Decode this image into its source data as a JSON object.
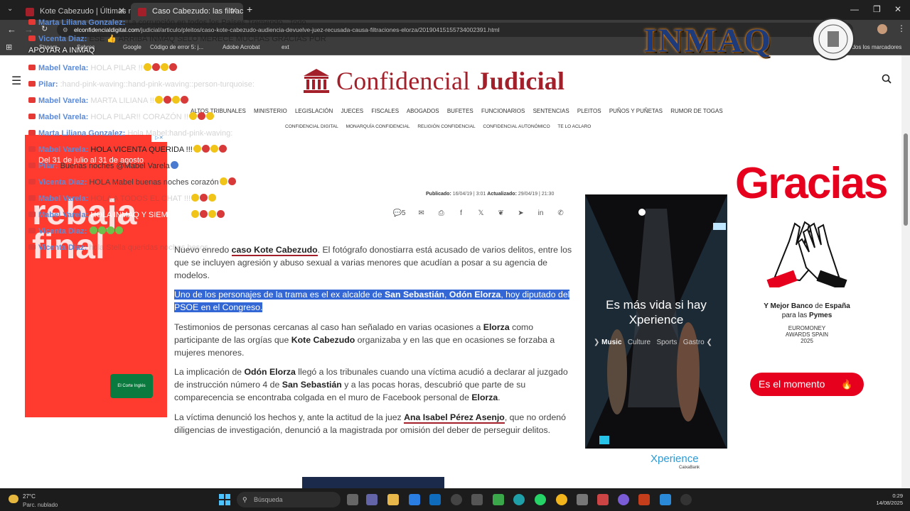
{
  "browser": {
    "tabs": [
      {
        "label": "Kote Cabezudo | Últimas notici",
        "active": false
      },
      {
        "label": "Caso Cabezudo: las filtraciones",
        "active": true
      }
    ],
    "url_host": "elconfidencialdigital.com",
    "url_path": "/judicial/articulo/pleitos/caso-kote-cabezudo-audiencia-devuelve-juez-recusada-causa-filtraciones-elorza/20190415155734002391.html",
    "bookmarks": [
      "Stream",
      "Sobres",
      "Google",
      "Código de error 5: j...",
      "Adobe Acrobat",
      "ext",
      "Todos los marcadores"
    ]
  },
  "chat": [
    {
      "name": "Marta Liliana Gonzalez",
      "text": "La corrupción en todos los Países Tremendo...Todo...",
      "style": "dark"
    },
    {
      "name": "Vicenta Diaz",
      "text": "ESE 👍 ARRIBA INMAQ SELO MERECE MUCHAS GRACIAS POR",
      "style": "dark"
    },
    {
      "name": "",
      "text": "APOYAR A INMAQ",
      "style": "white"
    },
    {
      "name": "Mabel Varela",
      "text": "HOLA PILAR !!",
      "style": "faint"
    },
    {
      "name": "Pilar",
      "text": ":hand-pink-waving::hand-pink-waving::person-turquoise:",
      "style": "faint"
    },
    {
      "name": "Mabel Varela",
      "text": "MARTA LILIANA !!",
      "style": "faint"
    },
    {
      "name": "Mabel Varela",
      "text": "HOLA PILAR!! CORAZÓN !!",
      "style": "faint"
    },
    {
      "name": "Marta Liliana Gonzalez",
      "text": "Hola Mabel:hand-pink-waving:",
      "style": "faint"
    },
    {
      "name": "Mabel Varela",
      "text": "HOLA VICENTA QUERIDA !!!",
      "style": "dark"
    },
    {
      "name": "Pilar",
      "text": "Buenas noches @Mabel Varela",
      "style": "faint"
    },
    {
      "name": "Vicenta Diaz",
      "text": "HOLA Mabel buenas noches corazón",
      "style": "faint"
    },
    {
      "name": "Mabel Varela",
      "text": "HOLA A TODOS EL CHAT !!!",
      "style": "faint"
    },
    {
      "name": "Mabel Varela",
      "text": "HOLA INMAQ Y SIEMPRE !!",
      "style": "dark"
    },
    {
      "name": "Vicenta Diaz",
      "text": "",
      "style": "faint"
    },
    {
      "name": "Vicenta Diaz",
      "text": "hola Stella queridas noches besos",
      "style": "faint"
    }
  ],
  "watermark": "INMAQ",
  "site": {
    "logo_light": "Confidencial",
    "logo_bold": "Judicial",
    "nav_main": [
      "ALTOS TRIBUNALES",
      "MINISTERIO",
      "LEGISLACIÓN",
      "JUECES",
      "FISCALES",
      "ABOGADOS",
      "BUFETES",
      "FUNCIONARIOS",
      "SENTENCIAS",
      "PLEITOS",
      "PUÑOS Y PUÑETAS",
      "RUMOR DE TOGAS"
    ],
    "nav_secondary": [
      "CONFIDENCIAL DIGITAL",
      "MONARQUÍA CONFIDENCIAL",
      "RELIGIÓN CONFIDENCIAL",
      "CONFIDENCIAL AUTONÓMICO",
      "TE LO ACLARO"
    ]
  },
  "article": {
    "published_label": "Publicado:",
    "published": "16/04/19 | 3:01",
    "updated_label": "Actualizado:",
    "updated": "29/04/19 | 21:30",
    "comments": "5",
    "p1_a": "Nuevo enredo ",
    "p1_link": "caso Kote Cabezudo",
    "p1_b": ". El fotógrafo donostiarra está acusado de varios delitos, entre los que se incluyen agresión y abuso sexual a varias menores que acudían a posar a su agencia de modelos.",
    "p2_a": "Uno de los personajes de la trama es el ex alcalde de ",
    "p2_b1": "San Sebastián",
    "p2_c": ", ",
    "p2_b2": "Odón Elorza",
    "p2_d": ", hoy diputado del PSOE en el Congreso.",
    "p3_a": "Testimonios de personas cercanas al caso han señalado en varias ocasiones a ",
    "p3_b1": "Elorza",
    "p3_c": " como participante de las orgías que ",
    "p3_b2": "Kote Cabezudo",
    "p3_d": " organizaba y en las que en ocasiones se forzaba a mujeres menores.",
    "p4_a": "La implicación de ",
    "p4_b1": "Odón Elorza",
    "p4_c": " llegó a los tribunales cuando una víctima acudió a declarar al juzgado de instrucción número 4 de ",
    "p4_b2": "San Sebastián",
    "p4_d": " y a las pocas horas, descubrió que parte de su comparecencia se encontraba colgada en el muro de Facebook personal de ",
    "p4_b3": "Elorza",
    "p4_e": ".",
    "p5_a": "La víctima denunció los hechos y, ante la actitud de la juez ",
    "p5_link": "Ana Isabel Pérez Asenjo",
    "p5_b": ", que no ordenó diligencias de investigación, denunció  a la magistrada por omisión del deber de perseguir delitos."
  },
  "ads": {
    "left_date": "Del 31 de julio al 31 de agosto",
    "left_big": "rebaja final",
    "left_brand": "El Corte Inglés",
    "mid_slogan": "Es más vida si hay Xperience",
    "mid_tags": [
      "Music",
      "Culture",
      "Sports",
      "Gastro"
    ],
    "mid_brand": "Xperience",
    "mid_sub": "CaixaBank",
    "right_big": "Gracias",
    "right_sub_a": "Y Mejor Banco",
    "right_sub_b": " de ",
    "right_sub_c": "España",
    "right_sub_d": "para las ",
    "right_sub_e": "Pymes",
    "right_award": "EUROMONEY AWARDS SPAIN 2025",
    "right_cta": "Es el momento"
  },
  "taskbar": {
    "temp": "27°C",
    "weather": "Parc. nublado",
    "search_placeholder": "Búsqueda",
    "time": "0:29",
    "date": "14/08/2025"
  },
  "colors": {
    "brand": "#a31f2a",
    "highlight": "#3367d6",
    "ad_red": "#e6001e"
  }
}
